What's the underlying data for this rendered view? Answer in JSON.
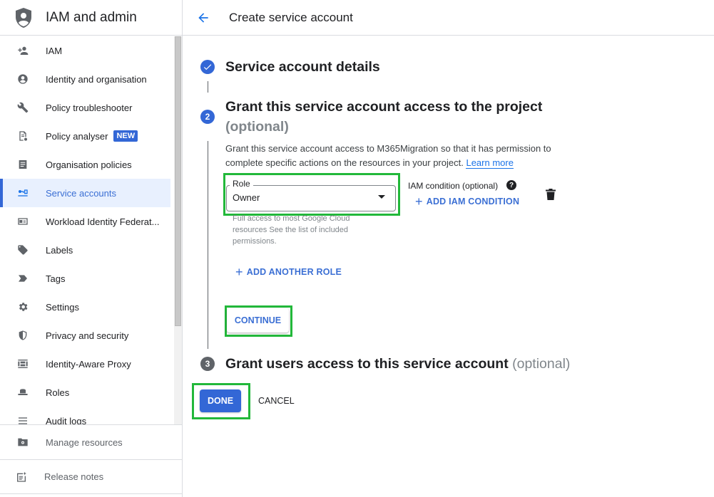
{
  "app": {
    "title": "IAM and admin"
  },
  "sidebar": {
    "items": [
      {
        "label": "IAM",
        "icon": "person-add-icon"
      },
      {
        "label": "Identity and organisation",
        "icon": "account-circle-icon"
      },
      {
        "label": "Policy troubleshooter",
        "icon": "wrench-icon"
      },
      {
        "label": "Policy analyser",
        "icon": "policy-analyser-icon",
        "badge": "NEW"
      },
      {
        "label": "Organisation policies",
        "icon": "document-icon"
      },
      {
        "label": "Service accounts",
        "icon": "service-account-key-icon",
        "active": true
      },
      {
        "label": "Workload Identity Federat...",
        "icon": "id-card-icon"
      },
      {
        "label": "Labels",
        "icon": "label-icon"
      },
      {
        "label": "Tags",
        "icon": "tag-icon"
      },
      {
        "label": "Settings",
        "icon": "gear-icon"
      },
      {
        "label": "Privacy and security",
        "icon": "shield-icon"
      },
      {
        "label": "Identity-Aware Proxy",
        "icon": "proxy-icon"
      },
      {
        "label": "Roles",
        "icon": "hat-icon"
      },
      {
        "label": "Audit logs",
        "icon": "list-icon"
      }
    ],
    "footer": {
      "manage_resources": "Manage resources",
      "release_notes": "Release notes"
    }
  },
  "header": {
    "page_title": "Create service account"
  },
  "steps": {
    "step1": {
      "title": "Service account details",
      "status": "completed"
    },
    "step2": {
      "number": "2",
      "title": "Grant this service account access to the project",
      "optional": "(optional)",
      "description": "Grant this service account access to M365Migration so that it has permission to complete specific actions on the resources in your project.",
      "learn_more": "Learn more",
      "role": {
        "label": "Role",
        "value": "Owner",
        "help": "Full access to most Google Cloud resources See the list of included permissions."
      },
      "iam_condition_label": "IAM condition (optional)",
      "help_glyph": "?",
      "add_iam_condition": "ADD IAM CONDITION",
      "add_another_role": "ADD ANOTHER ROLE",
      "continue": "CONTINUE"
    },
    "step3": {
      "number": "3",
      "title": "Grant users access to this service account",
      "optional": "(optional)"
    }
  },
  "actions": {
    "done": "DONE",
    "cancel": "CANCEL"
  },
  "colors": {
    "accent": "#3367d6",
    "link": "#1a73e8",
    "highlight": "#22b83a"
  }
}
